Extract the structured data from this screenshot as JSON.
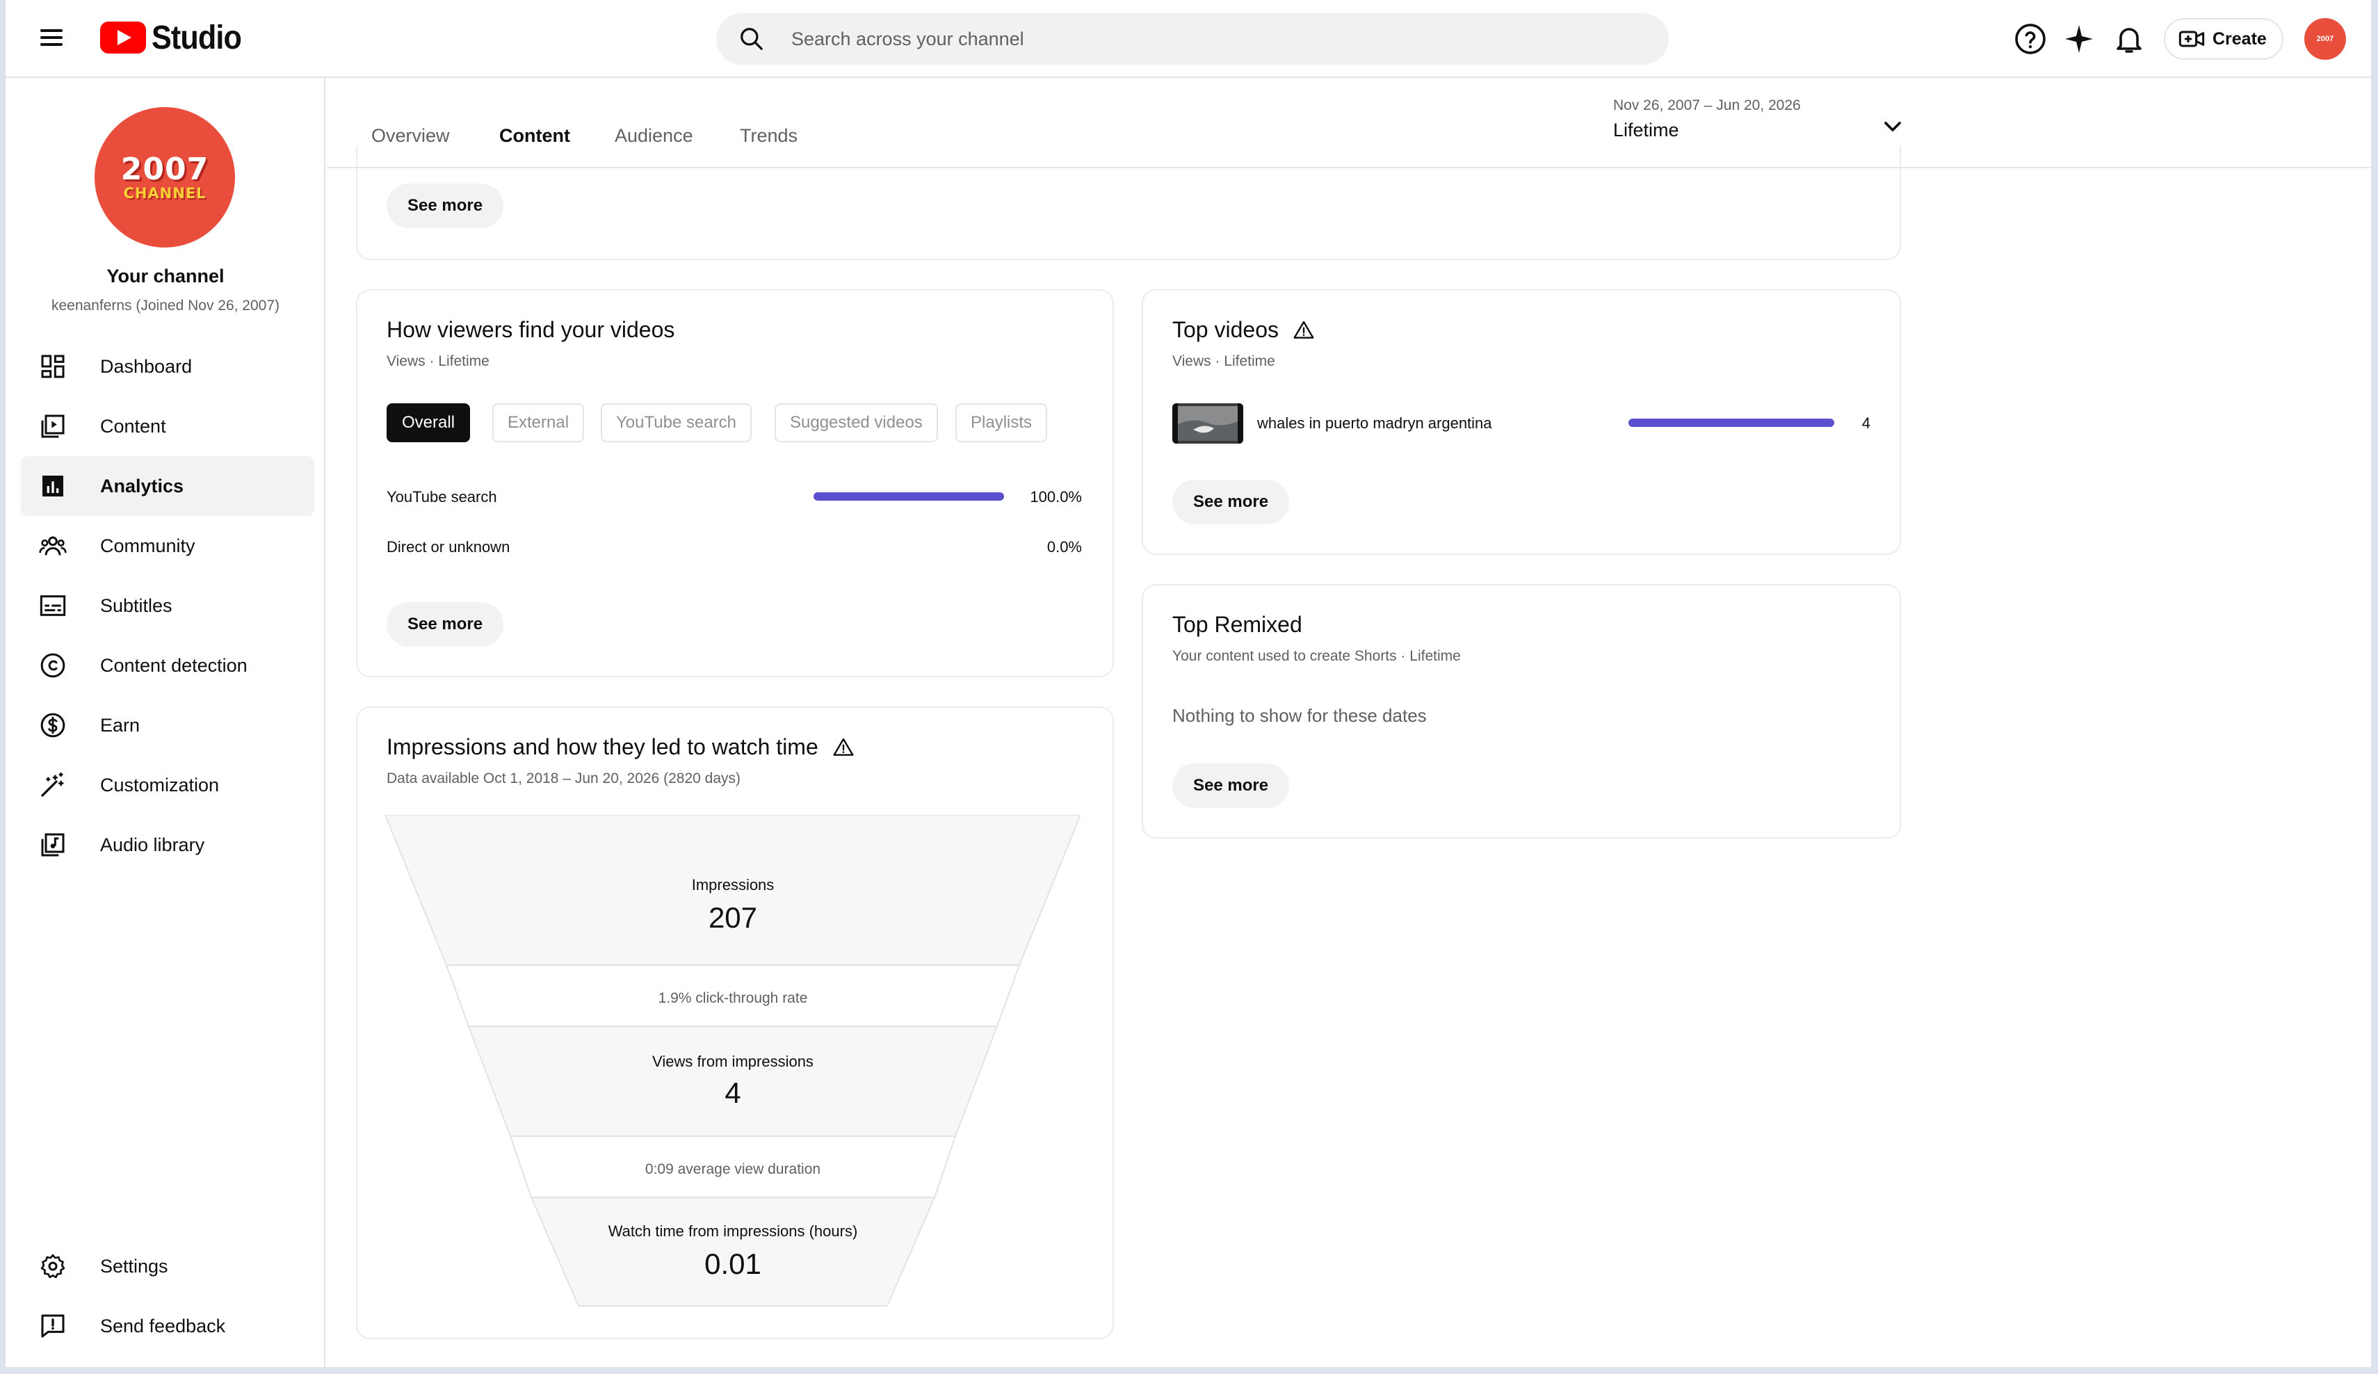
{
  "header": {
    "logo_text": "Studio",
    "search_placeholder": "Search across your channel",
    "create_label": "Create",
    "avatar_text": "2007"
  },
  "sidebar": {
    "channel_avatar_big": "2007",
    "channel_avatar_small": "CHANNEL",
    "channel_title": "Your channel",
    "channel_sub": "keenanferns (Joined Nov 26, 2007)",
    "items": [
      {
        "label": "Dashboard",
        "icon": "dashboard-icon"
      },
      {
        "label": "Content",
        "icon": "content-icon"
      },
      {
        "label": "Analytics",
        "icon": "analytics-icon",
        "active": true
      },
      {
        "label": "Community",
        "icon": "community-icon"
      },
      {
        "label": "Subtitles",
        "icon": "subtitles-icon"
      },
      {
        "label": "Content detection",
        "icon": "copyright-icon"
      },
      {
        "label": "Earn",
        "icon": "dollar-icon"
      },
      {
        "label": "Customization",
        "icon": "magic-wand-icon"
      },
      {
        "label": "Audio library",
        "icon": "audio-library-icon"
      }
    ],
    "footer": [
      {
        "label": "Settings",
        "icon": "gear-icon"
      },
      {
        "label": "Send feedback",
        "icon": "feedback-icon"
      }
    ]
  },
  "tabs": {
    "items": [
      "Overview",
      "Content",
      "Audience",
      "Trends"
    ],
    "active": "Content",
    "date_range": "Nov 26, 2007 – Jun 20, 2026",
    "period": "Lifetime"
  },
  "top_card": {
    "see_more": "See more"
  },
  "traffic": {
    "title": "How viewers find your videos",
    "subtitle": "Views · Lifetime",
    "chips": [
      "Overall",
      "External",
      "YouTube search",
      "Suggested videos",
      "Playlists"
    ],
    "active_chip": "Overall",
    "rows": [
      {
        "label": "YouTube search",
        "value": "100.0%",
        "fraction": 1.0
      },
      {
        "label": "Direct or unknown",
        "value": "0.0%",
        "fraction": 0.0
      }
    ],
    "see_more": "See more"
  },
  "impressions": {
    "title": "Impressions and how they led to watch time",
    "subtitle": "Data available Oct 1, 2018 – Jun 20, 2026 (2820 days)",
    "impressions_label": "Impressions",
    "impressions_value": "207",
    "ctr_text": "1.9% click-through rate",
    "views_label": "Views from impressions",
    "views_value": "4",
    "avd_text": "0:09 average view duration",
    "watch_label": "Watch time from impressions (hours)",
    "watch_value": "0.01"
  },
  "top_videos": {
    "title": "Top videos",
    "subtitle": "Views · Lifetime",
    "items": [
      {
        "title": "whales in puerto madryn argentina",
        "value": "4",
        "fraction": 1.0
      }
    ],
    "see_more": "See more"
  },
  "top_remixed": {
    "title": "Top Remixed",
    "subtitle": "Your content used to create Shorts · Lifetime",
    "empty_text": "Nothing to show for these dates",
    "see_more": "See more"
  },
  "colors": {
    "accent": "#5a4fcf",
    "brand": "#ff0000",
    "avatar": "#e94e3d"
  }
}
